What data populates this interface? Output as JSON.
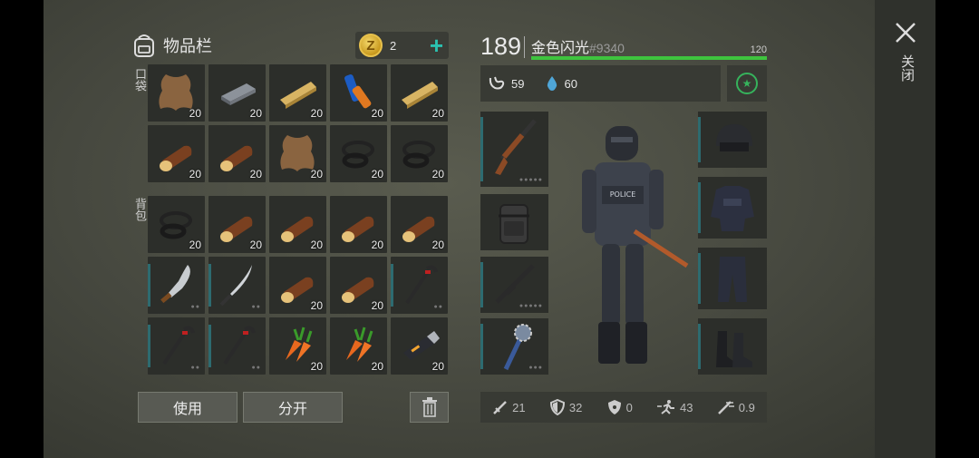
{
  "inventory": {
    "title": "物品栏",
    "coins": "2",
    "pocket_label": "口袋",
    "backpack_label": "背包",
    "pocket_slots": [
      {
        "icon": "leather-icon",
        "count": "20"
      },
      {
        "icon": "iron-bar-icon",
        "count": "20"
      },
      {
        "icon": "plank-icon",
        "count": "20"
      },
      {
        "icon": "battery-icon",
        "count": "20"
      },
      {
        "icon": "plank-icon",
        "count": "20"
      },
      {
        "icon": "log-icon",
        "count": "20"
      },
      {
        "icon": "log-icon",
        "count": "20"
      },
      {
        "icon": "leather-icon",
        "count": "20"
      },
      {
        "icon": "rope-icon",
        "count": "20"
      },
      {
        "icon": "rope-icon",
        "count": "20"
      }
    ],
    "backpack_slots": [
      {
        "icon": "rope-icon",
        "count": "20"
      },
      {
        "icon": "log-icon",
        "count": "20"
      },
      {
        "icon": "log-icon",
        "count": "20"
      },
      {
        "icon": "log-icon",
        "count": "20"
      },
      {
        "icon": "log-icon",
        "count": "20"
      },
      {
        "icon": "machete-icon",
        "count": ""
      },
      {
        "icon": "katana-icon",
        "count": ""
      },
      {
        "icon": "log-icon",
        "count": "20"
      },
      {
        "icon": "log-icon",
        "count": "20"
      },
      {
        "icon": "crowbar-icon",
        "count": ""
      },
      {
        "icon": "crowbar-icon",
        "count": ""
      },
      {
        "icon": "crowbar-icon",
        "count": ""
      },
      {
        "icon": "carrot-icon",
        "count": "20"
      },
      {
        "icon": "carrot-icon",
        "count": "20"
      },
      {
        "icon": "usb-drive-icon",
        "count": "20"
      }
    ],
    "use_button": "使用",
    "split_button": "分开"
  },
  "character": {
    "level": "189",
    "name": "金色闪光",
    "tag": "#9340",
    "xp_max": "120",
    "xp_fraction": 1.0,
    "hunger": "59",
    "thirst": "60"
  },
  "equipment": {
    "weapon_main": "shotgun-icon",
    "backpack": "backpack-icon",
    "weapon_secondary": "rifle-icon",
    "melee": "spiked-club-icon",
    "helmet": "helmet-icon",
    "armor": "police-vest-icon",
    "pants": "pants-icon",
    "boots": "boots-icon"
  },
  "stats": {
    "damage": "21",
    "defense": "32",
    "toxic": "0",
    "speed": "43",
    "attack_speed": "0.9"
  },
  "ui": {
    "close_label": "关闭"
  },
  "colors": {
    "accent_teal": "#2bc1b0",
    "xp_green": "#3ec43e",
    "tier_teal": "#2d6b70"
  }
}
